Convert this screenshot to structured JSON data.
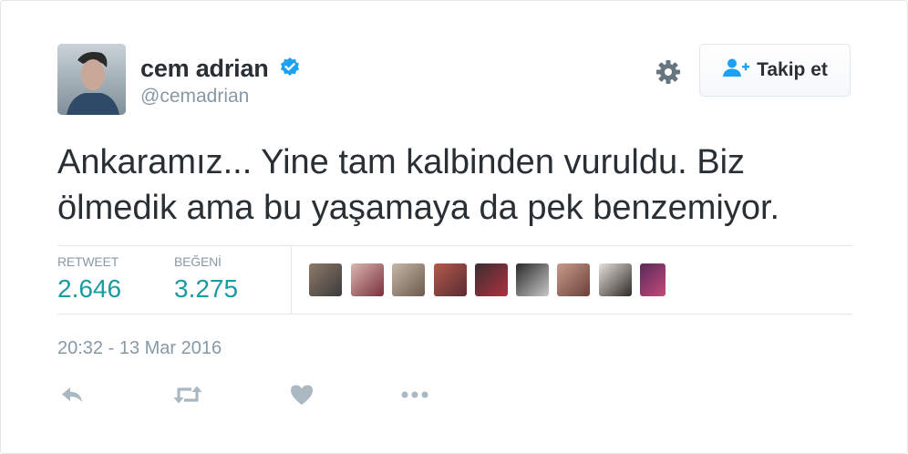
{
  "user": {
    "name": "cem adrian",
    "handle": "@cemadrian",
    "verified": true
  },
  "follow_button": {
    "label": "Takip et",
    "icon": "add-user-icon"
  },
  "settings_icon": "gear-icon",
  "tweet": {
    "line1": "Ankaramız... Yine tam kalbinden vuruldu. Biz",
    "line2": "ölmedik ama bu yaşamaya da pek benzemiyor."
  },
  "stats": {
    "retweets": {
      "label": "RETWEET",
      "value": "2.646"
    },
    "likes": {
      "label": "BEĞENİ",
      "value": "3.275"
    }
  },
  "liker_avatars_count": 9,
  "timestamp": "20:32 - 13 Mar 2016",
  "actions": [
    "reply-icon",
    "retweet-icon",
    "like-icon",
    "more-icon"
  ],
  "colors": {
    "accent": "#1da1f2",
    "stat_value": "#1a9ba0",
    "muted": "#8899a6",
    "text": "#292f33"
  }
}
